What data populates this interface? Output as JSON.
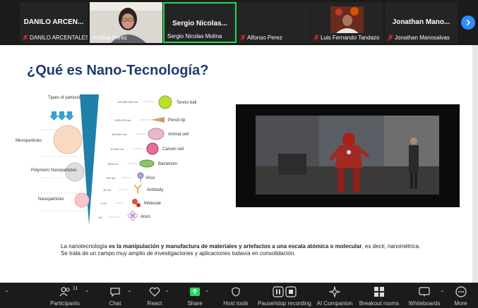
{
  "participants": [
    {
      "display": "DANILO  ARCEN...",
      "name": "DANILO ARCENTALES",
      "muted": true,
      "video": false
    },
    {
      "display": "",
      "name": "Andrea Perez",
      "muted": false,
      "video": true
    },
    {
      "display": "Sergio  Nicolas...",
      "name": "Sergio Nicolas Molina",
      "muted": false,
      "video": false,
      "active": true
    },
    {
      "display": "",
      "name": "Alfonso Perez",
      "muted": true,
      "video": false
    },
    {
      "display": "",
      "name": "Luis Fernando Tandazo",
      "muted": true,
      "video": true
    },
    {
      "display": "Jonathan  Mano...",
      "name": "Jonathan Manosalvas",
      "muted": true,
      "video": false
    }
  ],
  "slide": {
    "title": "¿Qué es Nano-Tecnología?",
    "caption_intro": "La nanotecnología ",
    "caption_bold": "es la manipulación y manufactura de materiales y artefactos a una escala atómica o molecular",
    "caption_rest": ", es decir, nanométrica. Se trata de un campo muy amplio de investigaciones y aplicaciones todavía en consolidación.",
    "diagram": {
      "types_label": "Types of particulates",
      "left_labels": [
        "Microparticles",
        "Polymeric Nanoparticles",
        "Nanoparticles"
      ],
      "right_labels": [
        "Tennis ball",
        "Pencil tip",
        "Animal cell",
        "Cancer cell",
        "Bacterium",
        "Virus",
        "Antibody",
        "Molecule",
        "Atom"
      ],
      "scale_labels": [
        "100,000,000 nm",
        "1000,000 nm",
        "100,000 nm",
        "10,000 nm",
        "1000 nm",
        "100 nm",
        "10 nm",
        "1 nm",
        "1A°"
      ]
    }
  },
  "toolbar": {
    "participants_label": "Participants",
    "participants_count": "11",
    "chat_label": "Chat",
    "react_label": "React",
    "share_label": "Share",
    "host_tools_label": "Host tools",
    "record_label": "Pause/stop recording",
    "ai_label": "AI Companion",
    "breakout_label": "Breakout rooms",
    "whiteboards_label": "Whiteboards",
    "more_label": "More"
  },
  "colors": {
    "accent_green": "#23d959",
    "accent_blue": "#2d8cff",
    "title_blue": "#1f3b6f",
    "muted_red": "#e02828"
  }
}
